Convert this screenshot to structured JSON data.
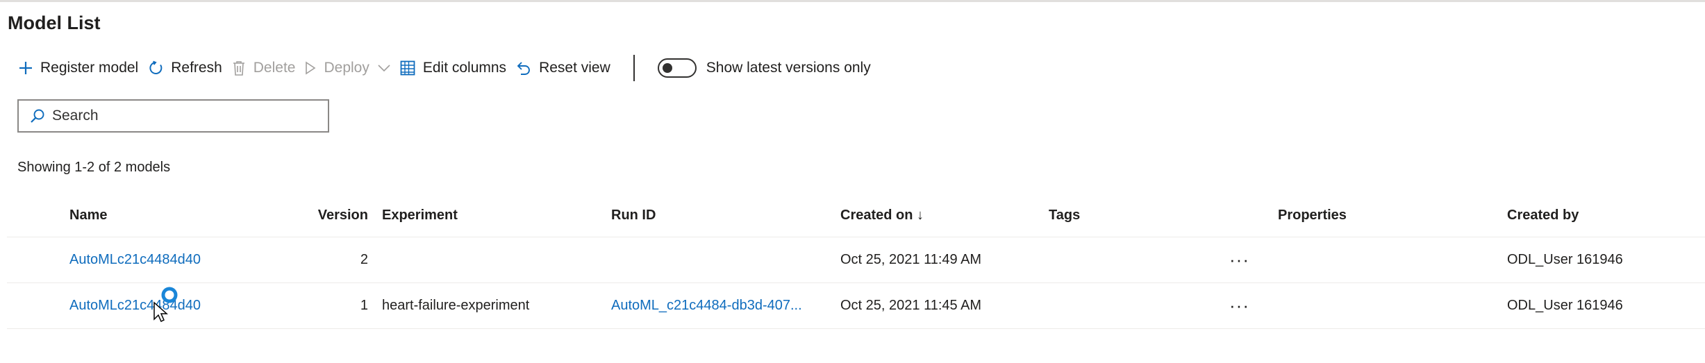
{
  "page": {
    "title": "Model List"
  },
  "toolbar": {
    "register_label": "Register model",
    "refresh_label": "Refresh",
    "delete_label": "Delete",
    "deploy_label": "Deploy",
    "edit_columns_label": "Edit columns",
    "reset_view_label": "Reset view",
    "toggle_label": "Show latest versions only",
    "toggle_on": false
  },
  "search": {
    "placeholder": "Search",
    "value": ""
  },
  "summary": "Showing 1-2 of 2 models",
  "table": {
    "columns": {
      "name": "Name",
      "version": "Version",
      "experiment": "Experiment",
      "run_id": "Run ID",
      "created_on": "Created on ↓",
      "tags": "Tags",
      "properties": "Properties",
      "created_by": "Created by"
    },
    "rows": [
      {
        "name": "AutoMLc21c4484d40",
        "version": "2",
        "experiment": "",
        "run_id": "",
        "created_on": "Oct 25, 2021 11:49 AM",
        "tags": "",
        "more": "···",
        "properties": "",
        "created_by": "ODL_User 161946"
      },
      {
        "name": "AutoMLc21c4484d40",
        "version": "1",
        "experiment": "heart-failure-experiment",
        "run_id": "AutoML_c21c4484-db3d-407...",
        "created_on": "Oct 25, 2021 11:45 AM",
        "tags": "",
        "more": "···",
        "properties": "",
        "created_by": "ODL_User 161946"
      }
    ]
  },
  "colors": {
    "accent": "#0f6cbd",
    "text": "#201f1e",
    "disabled": "#a19f9d",
    "border": "#8a8886"
  }
}
